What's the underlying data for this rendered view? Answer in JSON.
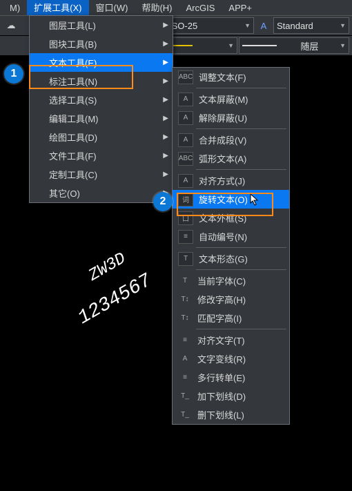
{
  "menubar": {
    "m_label": "M)",
    "extend_label": "扩展工具(X)",
    "window_label": "窗口(W)",
    "help_label": "帮助(H)",
    "arcgis_label": "ArcGIS",
    "app_label": "APP+"
  },
  "toolbar": {
    "iso_value": "ISO-25",
    "style_value": "Standard",
    "layer_value": "随层"
  },
  "main_menu": {
    "items": [
      {
        "label": "图层工具(L)"
      },
      {
        "label": "图块工具(B)"
      },
      {
        "label": "文本工具(E)"
      },
      {
        "label": "标注工具(N)"
      },
      {
        "label": "选择工具(S)"
      },
      {
        "label": "编辑工具(M)"
      },
      {
        "label": "绘图工具(D)"
      },
      {
        "label": "文件工具(F)"
      },
      {
        "label": "定制工具(C)"
      },
      {
        "label": "其它(O)"
      }
    ]
  },
  "submenu": {
    "groups": [
      [
        "调整文本(F)"
      ],
      [
        "文本屏蔽(M)",
        "解除屏蔽(U)"
      ],
      [
        "合并成段(V)",
        "弧形文本(A)"
      ],
      [
        "对齐方式(J)",
        "旋转文本(O)",
        "文本外框(S)",
        "自动编号(N)"
      ],
      [
        "文本形态(G)"
      ],
      [
        "当前字体(C)",
        "修改字高(H)",
        "匹配字高(I)"
      ],
      [
        "对齐文字(T)",
        "文字变线(R)",
        "多行转单(E)",
        "加下划线(D)",
        "删下划线(L)"
      ]
    ]
  },
  "icons": {
    "i0_0": "ABC",
    "i1_0": "A",
    "i1_1": "A",
    "i2_0": "A",
    "i2_1": "ABC",
    "i3_0": "A",
    "i3_1": "词",
    "i3_2": "口",
    "i3_3": "≡",
    "i4_0": "T",
    "i5_0": "T",
    "i5_1": "T↕",
    "i5_2": "T↕",
    "i6_0": "≡",
    "i6_1": "A",
    "i6_2": "≡",
    "i6_3": "T_",
    "i6_4": "T_"
  },
  "badges": {
    "step1": "1",
    "step2": "2"
  },
  "canvas": {
    "brand": "ZW3D",
    "numbers": "1234567"
  }
}
